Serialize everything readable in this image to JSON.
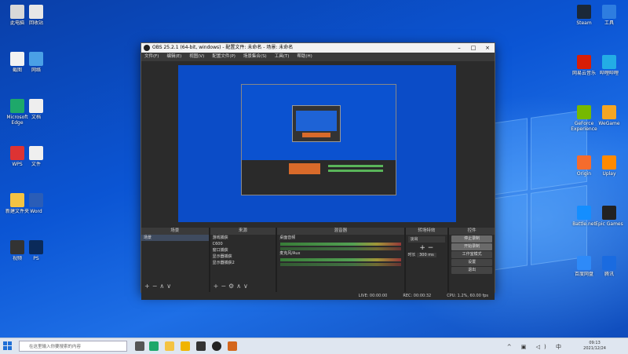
{
  "desktop": {
    "left_icons": [
      {
        "label": "此电脑",
        "color": "#d8d8d8"
      },
      {
        "label": "回收站",
        "color": "#e7e7e7"
      },
      {
        "label": "截图",
        "color": "#f2f2f2"
      },
      {
        "label": "网络",
        "color": "#4aa0e6"
      },
      {
        "label": "Microsoft Edge",
        "color": "#1ea86a"
      },
      {
        "label": "文档",
        "color": "#eeeeee"
      },
      {
        "label": "WPS",
        "color": "#d33"
      },
      {
        "label": "文件",
        "color": "#efefef"
      },
      {
        "label": "新建文件夹",
        "color": "#f4c342"
      },
      {
        "label": "Word",
        "color": "#2a5db7"
      },
      {
        "label": "视频",
        "color": "#333"
      },
      {
        "label": "PS",
        "color": "#0a2a5a"
      }
    ],
    "right_icons": [
      {
        "label": "Steam",
        "color": "#1b2838"
      },
      {
        "label": "工具",
        "color": "#2e7de0"
      },
      {
        "label": "网易云音乐",
        "color": "#d81e06"
      },
      {
        "label": "哔哩哔哩",
        "color": "#23ade5"
      },
      {
        "label": "GeForce Experience",
        "color": "#76b900"
      },
      {
        "label": "WeGame",
        "color": "#f5a623"
      },
      {
        "label": "Origin",
        "color": "#f56c2d"
      },
      {
        "label": "Uplay",
        "color": "#ff8a00"
      },
      {
        "label": "Battle.net",
        "color": "#148eff"
      },
      {
        "label": "Epic Games",
        "color": "#222"
      },
      {
        "label": "百度网盘",
        "color": "#2e8af8"
      },
      {
        "label": "腾讯",
        "color": "#1a6be0"
      }
    ]
  },
  "obs": {
    "title": "OBS 25.2.1 (64-bit, windows) - 配置文件: 未命名 - 场景: 未命名",
    "menu": [
      "文件(F)",
      "编辑(E)",
      "视图(V)",
      "配置文件(P)",
      "场景集合(S)",
      "工具(T)",
      "帮助(H)"
    ],
    "docks": {
      "scenes": {
        "header": "场景",
        "items": [
          "场景"
        ]
      },
      "sources": {
        "header": "来源",
        "items": [
          "游戏捕获",
          "C600",
          "窗口捕获",
          "显示器捕获",
          "显示器捕获2"
        ]
      },
      "mixer": {
        "header": "混音器",
        "tracks": [
          "桌面音频",
          "麦克风/Aux"
        ]
      },
      "transitions": {
        "header": "转场特效",
        "mode": "淡出",
        "duration_label": "时长",
        "duration": "300 ms"
      },
      "controls": {
        "header": "控件",
        "buttons": [
          "停止录制",
          "开始录制",
          "工作室模式",
          "设置",
          "退出"
        ]
      }
    },
    "status": [
      "LIVE: 00:00:00",
      "REC: 00:00:32",
      "CPU: 1.2%, 60.00 fps"
    ]
  },
  "taskbar": {
    "search_placeholder": "在这里输入你要搜索的内容",
    "time": "09:13",
    "date": "2021/12/24",
    "tray_icons": "^ ▣ ◁) 中"
  }
}
